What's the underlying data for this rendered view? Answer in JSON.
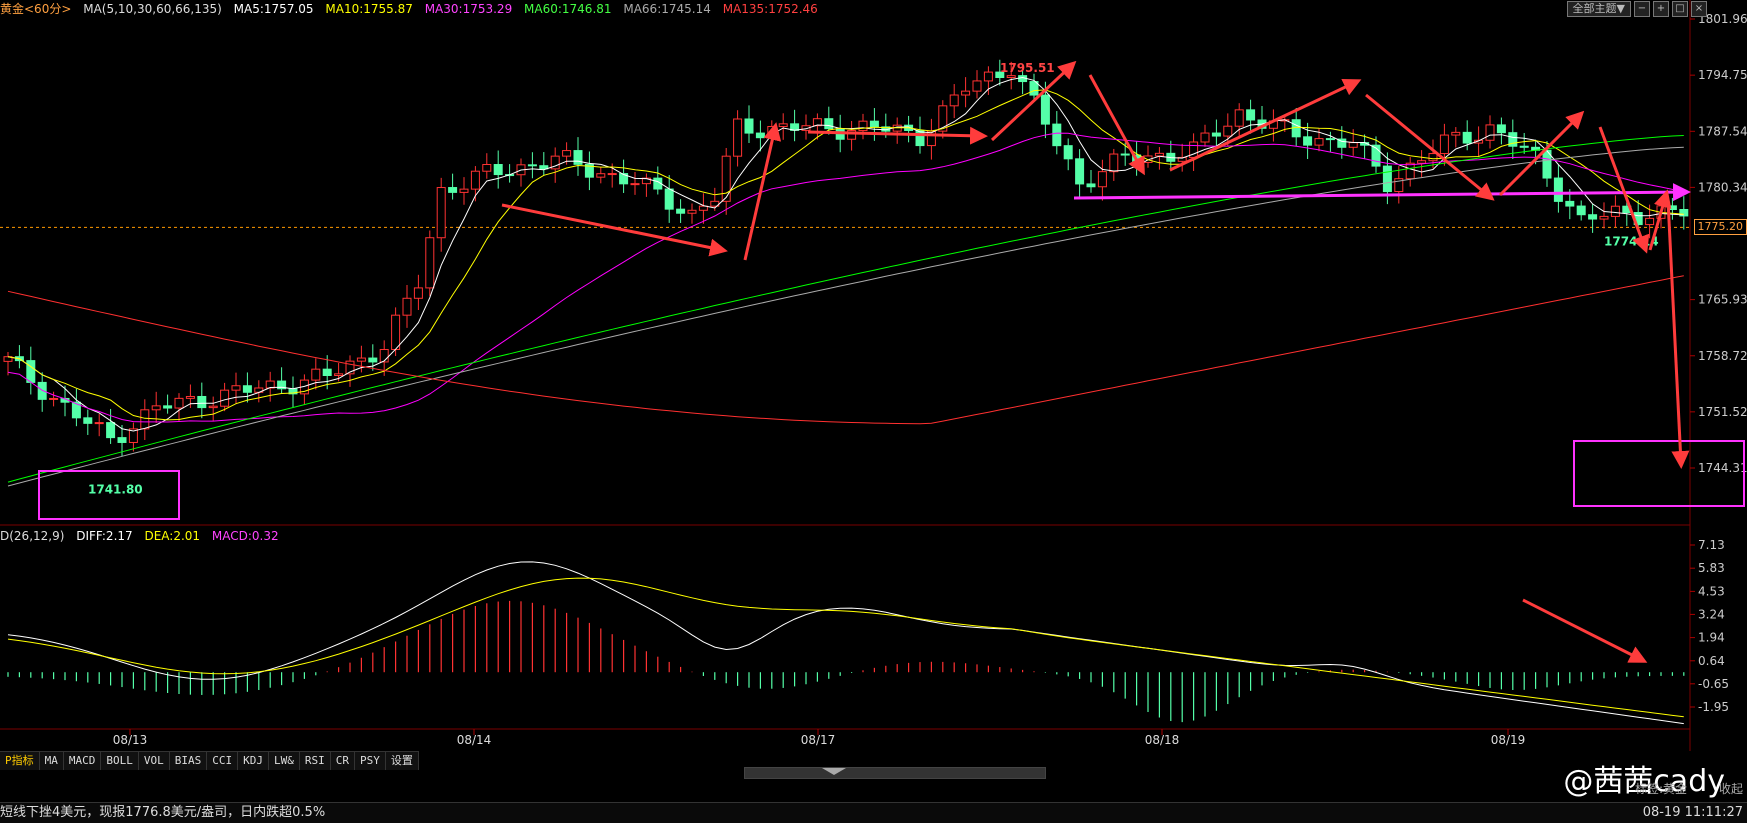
{
  "header": {
    "title": "黄金<60分>",
    "ma_params": "MA(5,10,30,60,66,135)",
    "ma5": "MA5:1757.05",
    "ma10": "MA10:1755.87",
    "ma30": "MA30:1753.29",
    "ma60": "MA60:1746.81",
    "ma66": "MA66:1745.14",
    "ma135": "MA135:1752.46"
  },
  "toolbar": {
    "theme_button": "全部主题▼"
  },
  "macd_header": {
    "params": "D(26,12,9)",
    "diff": "DIFF:2.17",
    "dea": "DEA:2.01",
    "macd": "MACD:0.32"
  },
  "current_price": "1775.20",
  "tabs": [
    "P指标",
    "MA",
    "MACD",
    "BOLL",
    "VOL",
    "BIAS",
    "CCI",
    "KDJ",
    "LW&",
    "RSI",
    "CR",
    "PSY",
    "设置"
  ],
  "status": {
    "message": "短线下挫4美元，现报1776.8美元/盎司，日内跌超0.5%",
    "datetime": "08-19 11:11:27"
  },
  "watermark": {
    "text": "@茜茜cady",
    "sub": "标签:黄金",
    "collapse": "收起"
  },
  "colors": {
    "ma5": "#ffffff",
    "ma10": "#ffff00",
    "ma30": "#ff00ff",
    "ma60": "#00ff00",
    "ma66": "#aaaaaa",
    "ma135": "#ff3030",
    "up": "#ff3232",
    "down": "#54ffa8",
    "annot": "#ff3c3c",
    "magenta": "#ff33ff"
  },
  "chart_data": {
    "type": "candlestick",
    "price_axis": [
      "1801.96",
      "1794.75",
      "1787.54",
      "1780.34",
      "1765.93",
      "1758.72",
      "1751.52",
      "1744.31"
    ],
    "macd_axis": [
      "7.13",
      "5.83",
      "4.53",
      "3.24",
      "1.94",
      "0.64",
      "-0.65",
      "-1.95"
    ],
    "date_labels": [
      "08/13",
      "08/14",
      "08/17",
      "08/18",
      "08/19"
    ],
    "annotations": {
      "high": "1795.51",
      "low": "1741.80",
      "recent_low": "1774.14"
    }
  }
}
